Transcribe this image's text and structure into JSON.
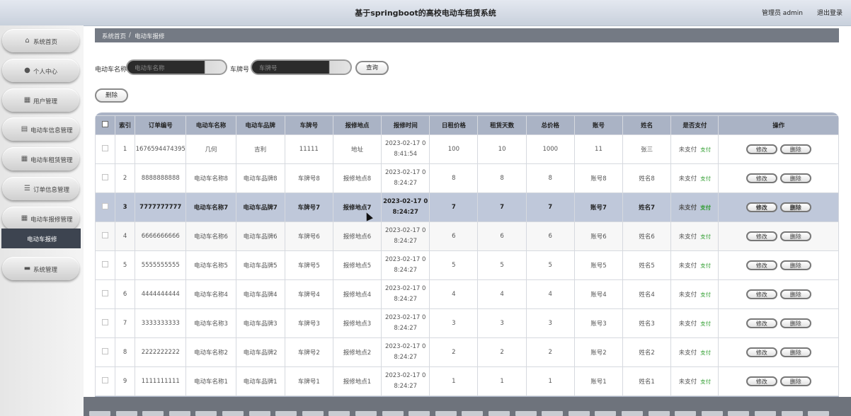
{
  "header": {
    "title": "基于springboot的高校电动车租赁系统",
    "user": "管理员 admin",
    "logout": "退出登录"
  },
  "sidebar": {
    "items": [
      {
        "label": "系统首页",
        "icon": "home-icon"
      },
      {
        "label": "个人中心",
        "icon": "user-icon"
      },
      {
        "label": "用户管理",
        "icon": "grid-icon"
      },
      {
        "label": "电动车信息管理",
        "icon": "info-icon"
      },
      {
        "label": "电动车租赁管理",
        "icon": "grid-icon"
      },
      {
        "label": "订单信息管理",
        "icon": "sliders-icon"
      },
      {
        "label": "电动车报修管理",
        "icon": "grid-icon"
      },
      {
        "label": "系统管理",
        "icon": "message-icon"
      }
    ],
    "submenu": {
      "label": "电动车报修"
    }
  },
  "breadcrumb": {
    "home": "系统首页",
    "separator": "/",
    "current": "电动车报修"
  },
  "search": {
    "name_label": "电动车名称",
    "name_placeholder": "电动车名称",
    "plate_label": "车牌号",
    "plate_placeholder": "车牌号",
    "query_button": "查询"
  },
  "toolbar": {
    "delete_button": "删除"
  },
  "table": {
    "headers": [
      "索引",
      "订单编号",
      "电动车名称",
      "电动车品牌",
      "车牌号",
      "报修地点",
      "报修时间",
      "日租价格",
      "租赁天数",
      "总价格",
      "账号",
      "姓名",
      "是否支付",
      "操作"
    ],
    "edit_label": "修改",
    "delete_label": "删除",
    "rows": [
      {
        "index": "1",
        "order": "1676594474395",
        "name": "几何",
        "brand": "吉利",
        "plate": "11111",
        "location": "地址",
        "time_date": "2023-02-17 0",
        "time_clock": "8:41:54",
        "daily": "100",
        "days": "10",
        "total": "1000",
        "account": "11",
        "person": "张三",
        "paid": "未支付",
        "pay": "支付"
      },
      {
        "index": "2",
        "order": "8888888888",
        "name": "电动车名称8",
        "brand": "电动车品牌8",
        "plate": "车牌号8",
        "location": "报修地点8",
        "time_date": "2023-02-17 0",
        "time_clock": "8:24:27",
        "daily": "8",
        "days": "8",
        "total": "8",
        "account": "账号8",
        "person": "姓名8",
        "paid": "未支付",
        "pay": "支付"
      },
      {
        "index": "3",
        "order": "7777777777",
        "name": "电动车名称7",
        "brand": "电动车品牌7",
        "plate": "车牌号7",
        "location": "报修地点7",
        "time_date": "2023-02-17 0",
        "time_clock": "8:24:27",
        "daily": "7",
        "days": "7",
        "total": "7",
        "account": "账号7",
        "person": "姓名7",
        "paid": "未支付",
        "pay": "支付"
      },
      {
        "index": "4",
        "order": "6666666666",
        "name": "电动车名称6",
        "brand": "电动车品牌6",
        "plate": "车牌号6",
        "location": "报修地点6",
        "time_date": "2023-02-17 0",
        "time_clock": "8:24:27",
        "daily": "6",
        "days": "6",
        "total": "6",
        "account": "账号6",
        "person": "姓名6",
        "paid": "未支付",
        "pay": "支付"
      },
      {
        "index": "5",
        "order": "5555555555",
        "name": "电动车名称5",
        "brand": "电动车品牌5",
        "plate": "车牌号5",
        "location": "报修地点5",
        "time_date": "2023-02-17 0",
        "time_clock": "8:24:27",
        "daily": "5",
        "days": "5",
        "total": "5",
        "account": "账号5",
        "person": "姓名5",
        "paid": "未支付",
        "pay": "支付"
      },
      {
        "index": "6",
        "order": "4444444444",
        "name": "电动车名称4",
        "brand": "电动车品牌4",
        "plate": "车牌号4",
        "location": "报修地点4",
        "time_date": "2023-02-17 0",
        "time_clock": "8:24:27",
        "daily": "4",
        "days": "4",
        "total": "4",
        "account": "账号4",
        "person": "姓名4",
        "paid": "未支付",
        "pay": "支付"
      },
      {
        "index": "7",
        "order": "3333333333",
        "name": "电动车名称3",
        "brand": "电动车品牌3",
        "plate": "车牌号3",
        "location": "报修地点3",
        "time_date": "2023-02-17 0",
        "time_clock": "8:24:27",
        "daily": "3",
        "days": "3",
        "total": "3",
        "account": "账号3",
        "person": "姓名3",
        "paid": "未支付",
        "pay": "支付"
      },
      {
        "index": "8",
        "order": "2222222222",
        "name": "电动车名称2",
        "brand": "电动车品牌2",
        "plate": "车牌号2",
        "location": "报修地点2",
        "time_date": "2023-02-17 0",
        "time_clock": "8:24:27",
        "daily": "2",
        "days": "2",
        "total": "2",
        "account": "账号2",
        "person": "姓名2",
        "paid": "未支付",
        "pay": "支付"
      },
      {
        "index": "9",
        "order": "1111111111",
        "name": "电动车名称1",
        "brand": "电动车品牌1",
        "plate": "车牌号1",
        "location": "报修地点1",
        "time_date": "2023-02-17 0",
        "time_clock": "8:24:27",
        "daily": "1",
        "days": "1",
        "total": "1",
        "account": "账号1",
        "person": "姓名1",
        "paid": "未支付",
        "pay": "支付"
      }
    ]
  },
  "colors": {
    "header_bg": "#d4dae4",
    "table_header_bg": "#aab3c5",
    "highlight_row_bg": "#bfc8da",
    "pay_link": "#2e9c2e",
    "submenu_bg": "#3d4450"
  }
}
